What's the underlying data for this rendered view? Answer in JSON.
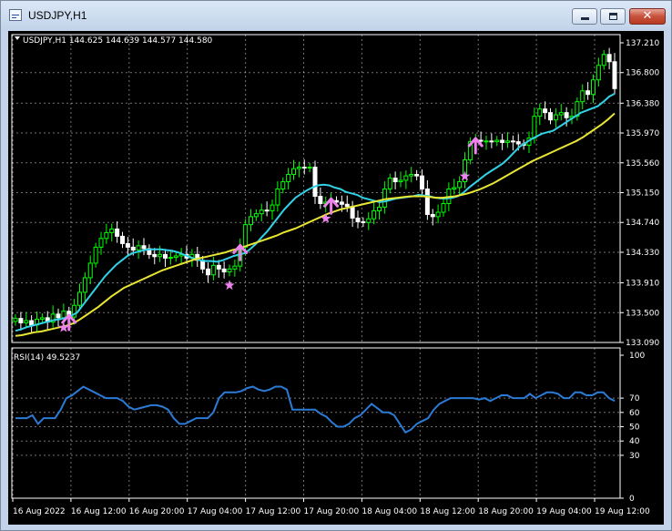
{
  "window": {
    "title": "USDJPY,H1",
    "icon": "chart-window-icon",
    "controls": {
      "minimize": "minimize-icon",
      "maximize": "maximize-icon",
      "close": "close-icon"
    }
  },
  "chart": {
    "header": "USDJPY,H1  144.625 144.639 144.577 144.580",
    "rsi_label": "RSI(14) 49.5237"
  },
  "colors": {
    "background": "#000000",
    "grid": "#ffffff",
    "bull_candle": "#00ff00",
    "bear_candle": "#ffffff",
    "fast_ma": "#32d2e6",
    "slow_ma": "#e8e633",
    "rsi_line": "#2b7bd6",
    "signal_marker": "#ee82ee"
  },
  "chart_data": [
    {
      "type": "candlestick",
      "title": "USDJPY,H1",
      "y_ticks": [
        "137.210",
        "136.800",
        "136.380",
        "135.970",
        "135.560",
        "135.150",
        "134.740",
        "134.330",
        "133.910",
        "133.500",
        "133.090"
      ],
      "ylim": [
        133.09,
        137.21
      ],
      "x_ticks": [
        "16 Aug 2022",
        "16 Aug 12:00",
        "16 Aug 20:00",
        "17 Aug 04:00",
        "17 Aug 12:00",
        "17 Aug 20:00",
        "18 Aug 04:00",
        "18 Aug 12:00",
        "18 Aug 20:00",
        "19 Aug 04:00",
        "19 Aug 12:00"
      ],
      "grid": true,
      "candles_close": [
        133.42,
        133.36,
        133.39,
        133.33,
        133.41,
        133.43,
        133.37,
        133.48,
        133.43,
        133.52,
        133.44,
        133.6,
        133.78,
        133.98,
        134.18,
        134.4,
        134.52,
        134.6,
        134.65,
        134.55,
        134.45,
        134.4,
        134.36,
        134.42,
        134.38,
        134.3,
        134.27,
        134.3,
        134.25,
        134.26,
        134.28,
        134.3,
        134.25,
        134.3,
        134.22,
        134.1,
        134.02,
        134.15,
        134.1,
        134.06,
        134.1,
        134.14,
        134.4,
        134.71,
        134.82,
        134.86,
        134.91,
        134.9,
        134.98,
        135.2,
        135.3,
        135.4,
        135.48,
        135.5,
        135.49,
        135.5,
        135.1,
        135.0,
        135.02,
        135.04,
        135.02,
        134.99,
        134.96,
        134.8,
        134.75,
        134.74,
        134.79,
        134.9,
        134.95,
        135.2,
        135.35,
        135.3,
        135.32,
        135.38,
        135.4,
        135.38,
        135.2,
        134.85,
        134.82,
        134.88,
        135.0,
        135.2,
        135.22,
        135.3,
        135.6,
        135.85,
        135.87,
        135.86,
        135.86,
        135.85,
        135.87,
        135.84,
        135.86,
        135.85,
        135.82,
        135.8,
        135.9,
        136.2,
        136.3,
        136.25,
        136.15,
        136.22,
        136.25,
        136.18,
        136.2,
        136.4,
        136.55,
        136.5,
        136.7,
        136.9,
        137.05,
        136.95,
        136.58
      ],
      "series": [
        {
          "name": "",
          "kind": "moving-average-fast",
          "values": [
            133.25,
            133.27,
            133.3,
            133.32,
            133.34,
            133.36,
            133.38,
            133.4,
            133.41,
            133.43,
            133.46,
            133.5,
            133.6,
            133.7,
            133.8,
            133.9,
            134.0,
            134.08,
            134.16,
            134.22,
            134.28,
            134.32,
            134.34,
            134.36,
            134.37,
            134.37,
            134.37,
            134.36,
            134.35,
            134.33,
            134.3,
            134.27,
            134.24,
            134.22,
            134.21,
            134.21,
            134.2,
            134.22,
            134.25,
            134.28,
            134.3,
            134.32,
            134.38,
            134.45,
            134.54,
            134.62,
            134.72,
            134.82,
            134.92,
            135.0,
            135.08,
            135.13,
            135.18,
            135.22,
            135.25,
            135.26,
            135.25,
            135.22,
            135.2,
            135.16,
            135.14,
            135.12,
            135.08,
            135.06,
            135.04,
            135.02,
            135.03,
            135.05,
            135.07,
            135.08,
            135.09,
            135.1,
            135.12,
            135.11,
            135.1,
            135.08,
            135.07,
            135.07,
            135.08,
            135.1,
            135.15,
            135.22,
            135.28,
            135.34,
            135.4,
            135.45,
            135.5,
            135.55,
            135.62,
            135.7,
            135.78,
            135.83,
            135.88,
            135.92,
            135.96,
            135.98,
            136.0,
            136.05,
            136.1,
            136.15,
            136.2,
            136.25,
            136.28,
            136.31,
            136.34,
            136.4,
            136.47,
            136.51
          ]
        },
        {
          "name": "",
          "kind": "moving-average-slow",
          "values": [
            133.18,
            133.19,
            133.21,
            133.23,
            133.24,
            133.26,
            133.28,
            133.3,
            133.32,
            133.35,
            133.4,
            133.46,
            133.52,
            133.58,
            133.65,
            133.72,
            133.78,
            133.84,
            133.88,
            133.92,
            133.96,
            134.0,
            134.04,
            134.08,
            134.11,
            134.14,
            134.17,
            134.2,
            134.23,
            134.25,
            134.27,
            134.29,
            134.31,
            134.33,
            134.36,
            134.38,
            134.41,
            134.44,
            134.47,
            134.5,
            134.53,
            134.56,
            134.6,
            134.63,
            134.66,
            134.7,
            134.74,
            134.78,
            134.82,
            134.86,
            134.89,
            134.92,
            134.94,
            134.96,
            134.98,
            135.0,
            135.02,
            135.04,
            135.06,
            135.07,
            135.08,
            135.09,
            135.1,
            135.1,
            135.1,
            135.09,
            135.08,
            135.08,
            135.09,
            135.1,
            135.12,
            135.14,
            135.17,
            135.2,
            135.24,
            135.28,
            135.33,
            135.38,
            135.43,
            135.48,
            135.53,
            135.58,
            135.62,
            135.66,
            135.7,
            135.74,
            135.78,
            135.82,
            135.86,
            135.91,
            135.97,
            136.03,
            136.09,
            136.16,
            136.24
          ]
        },
        {
          "name": "",
          "kind": "rsi",
          "y_ticks": [
            "100",
            "70",
            "60",
            "50",
            "40",
            "30",
            "0"
          ],
          "ylim": [
            0,
            100
          ],
          "values": [
            56,
            56,
            56,
            58,
            52,
            56,
            56,
            56,
            62,
            70,
            72,
            75,
            78,
            76,
            74,
            72,
            70,
            70,
            70,
            68,
            64,
            62,
            63,
            64,
            65,
            65,
            64,
            62,
            56,
            52,
            52,
            54,
            56,
            56,
            56,
            60,
            70,
            74,
            74,
            74,
            75,
            77,
            78,
            76,
            75,
            76,
            78,
            78,
            76,
            62,
            62,
            62,
            62,
            62,
            59,
            57,
            53,
            50,
            50,
            52,
            56,
            58,
            62,
            66,
            63,
            60,
            60,
            58,
            52,
            46,
            48,
            52,
            54,
            56,
            62,
            66,
            68,
            70,
            70,
            70,
            70,
            70,
            69,
            70,
            68,
            70,
            72,
            72,
            70,
            70,
            70,
            73,
            70,
            72,
            74,
            74,
            73,
            70,
            70,
            74,
            74,
            72,
            72,
            74,
            74,
            70,
            68
          ]
        }
      ],
      "signals": [
        {
          "kind": "up-arrow",
          "at": 10
        },
        {
          "kind": "up-arrow",
          "at": 42
        },
        {
          "kind": "up-arrow",
          "at": 59
        },
        {
          "kind": "up-arrow",
          "at": 86
        },
        {
          "kind": "star",
          "at": 9
        },
        {
          "kind": "star",
          "at": 40
        },
        {
          "kind": "star",
          "at": 58
        },
        {
          "kind": "star",
          "at": 84
        }
      ]
    }
  ]
}
